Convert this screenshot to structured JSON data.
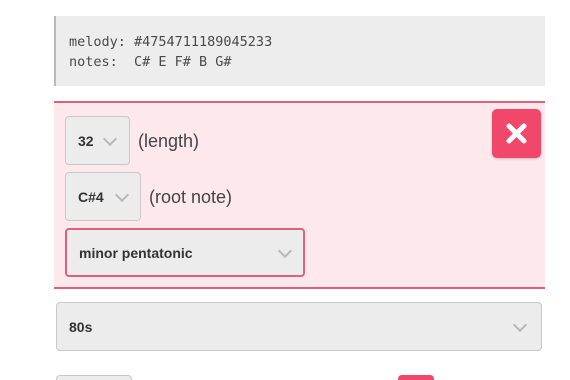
{
  "code_block": {
    "line1": "melody: #4754711189045233",
    "line2": "notes:  C# E F# B G#"
  },
  "panel": {
    "length_select": {
      "value": "32"
    },
    "length_label": "(length)",
    "root_select": {
      "value": "C#4"
    },
    "root_label": "(root note)",
    "scale_select": {
      "value": "minor pentatonic"
    },
    "remove_button": {
      "icon": "close-icon"
    },
    "accent_color": "#f0476b"
  },
  "style_select": {
    "value": "80s"
  }
}
